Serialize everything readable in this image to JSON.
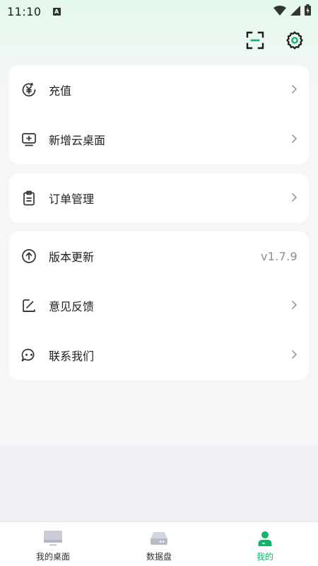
{
  "status_bar": {
    "time": "11:10",
    "notification_badge": "A"
  },
  "header": {
    "scan_icon": "scan-icon",
    "settings_icon": "gear-icon"
  },
  "groups": [
    {
      "items": [
        {
          "label": "充值",
          "icon": "yuan-recharge-icon"
        },
        {
          "label": "新增云桌面",
          "icon": "add-desktop-icon"
        }
      ]
    },
    {
      "items": [
        {
          "label": "订单管理",
          "icon": "clipboard-icon"
        }
      ]
    },
    {
      "items": [
        {
          "label": "版本更新",
          "icon": "upload-circle-icon",
          "value": "v1.7.9"
        },
        {
          "label": "意见反馈",
          "icon": "edit-icon"
        },
        {
          "label": "联系我们",
          "icon": "chat-bubbles-icon"
        }
      ]
    }
  ],
  "tabs": [
    {
      "label": "我的桌面",
      "icon": "monitor-icon",
      "active": false
    },
    {
      "label": "数据盘",
      "icon": "disk-icon",
      "active": false
    },
    {
      "label": "我的",
      "icon": "user-icon",
      "active": true
    }
  ],
  "colors": {
    "accent": "#0fb56a",
    "card_bg": "#ffffff",
    "page_bg": "#f4f6f8"
  }
}
